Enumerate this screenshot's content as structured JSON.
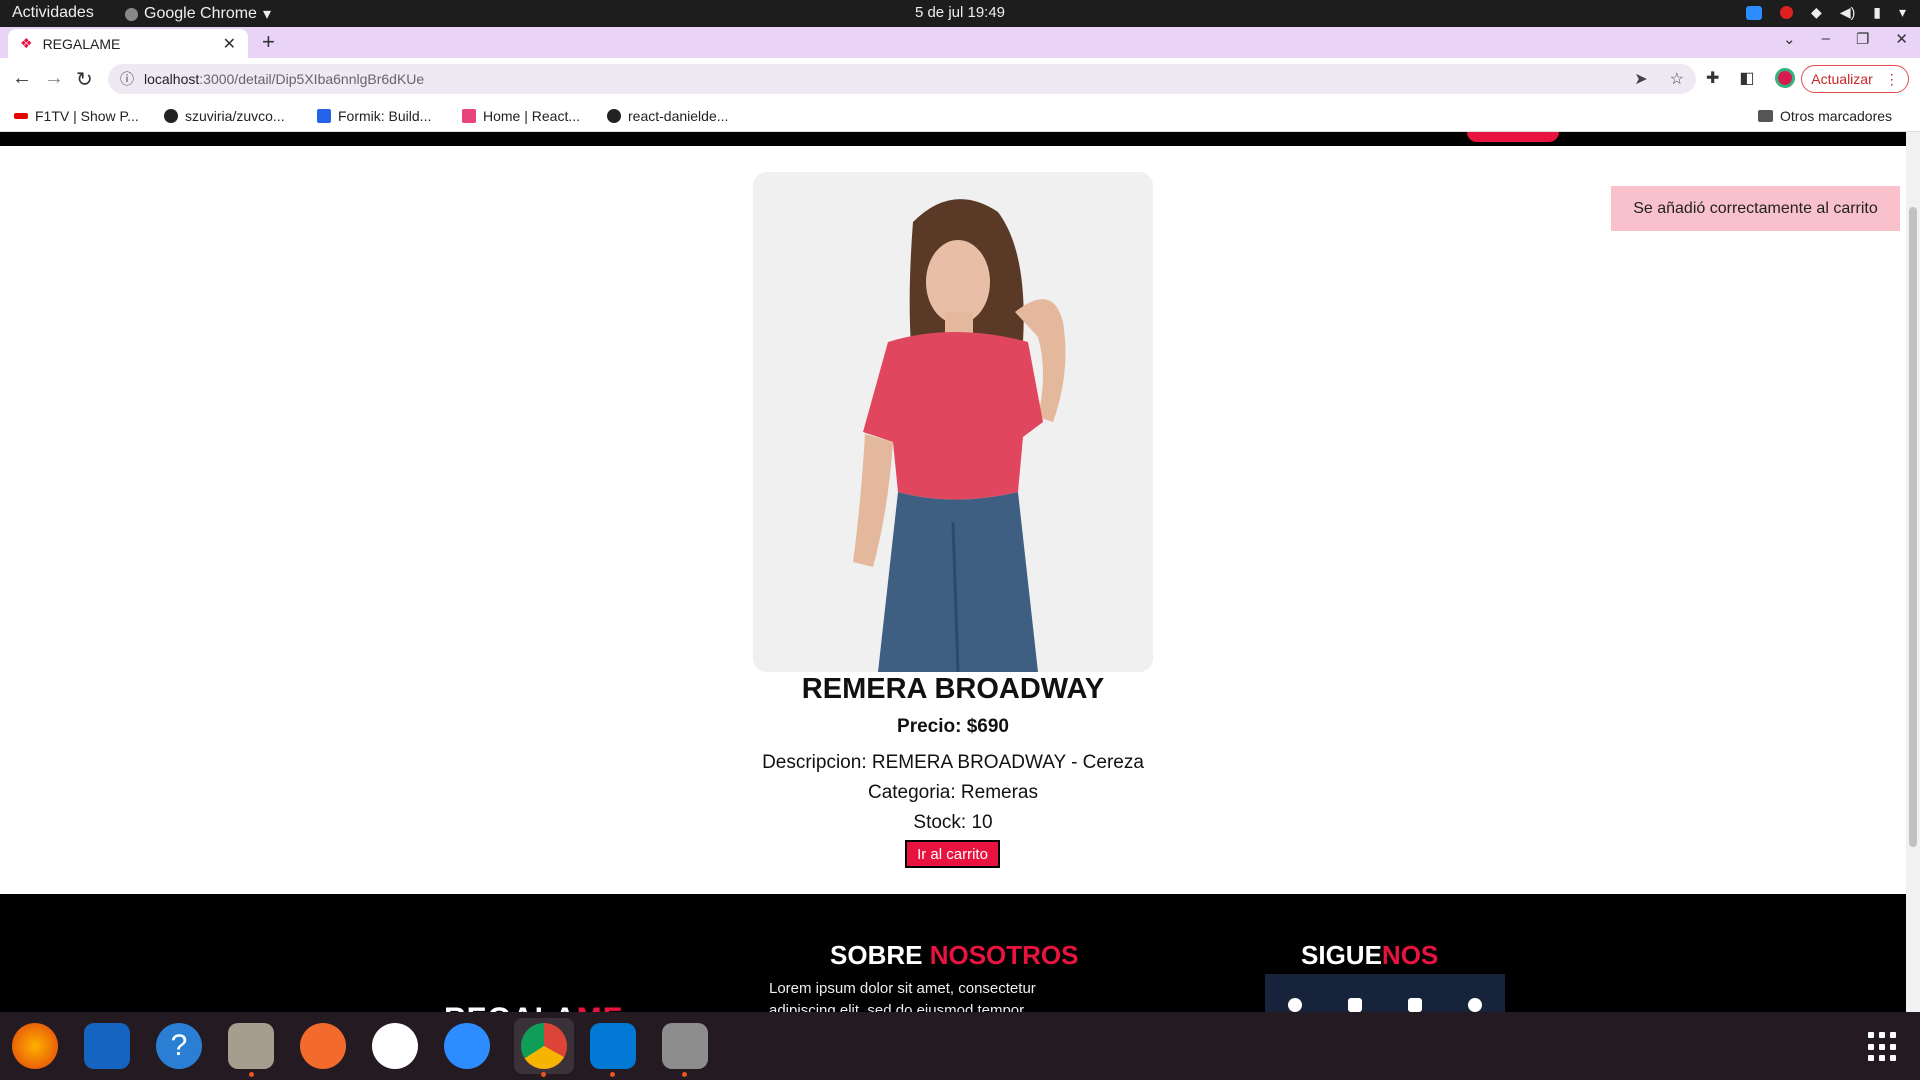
{
  "system": {
    "activities": "Actividades",
    "app_name": "Google Chrome",
    "clock": "5 de jul  19:49"
  },
  "browser": {
    "tab_title": "REGALAME",
    "url_host": "localhost",
    "url_path": ":3000/detail/Dip5XIba6nnlgBr6dKUe",
    "update_label": "Actualizar",
    "bookmarks": [
      {
        "label": "F1TV | Show P...",
        "icon": "f1-icon"
      },
      {
        "label": "szuviria/zuvco...",
        "icon": "github-icon"
      },
      {
        "label": "Formik: Build...",
        "icon": "formik-icon"
      },
      {
        "label": "Home | React...",
        "icon": "react-icon"
      },
      {
        "label": "react-danielde...",
        "icon": "github-icon"
      }
    ],
    "other_bookmarks": "Otros marcadores"
  },
  "toast": {
    "message": "Se añadió correctamente al carrito"
  },
  "product": {
    "name": "REMERA BROADWAY",
    "price": "Precio: $690",
    "description": "Descripcion: REMERA BROADWAY - Cereza",
    "category": "Categoria: Remeras",
    "stock": "Stock: 10",
    "cart_button": "Ir al carrito"
  },
  "footer": {
    "brand_a": "REGALA",
    "brand_b": "ME",
    "about_a": "SOBRE ",
    "about_b": "NOSOTROS",
    "about_text": "Lorem ipsum dolor sit amet, consectetur adipiscing elit, sed do eiusmod tempor incididunt",
    "follow_a": "SIGUE",
    "follow_b": "NOS"
  },
  "colors": {
    "accent": "#e8133f",
    "toast_bg": "#f9c1cc",
    "tabstrip": "#e9d4f8"
  }
}
